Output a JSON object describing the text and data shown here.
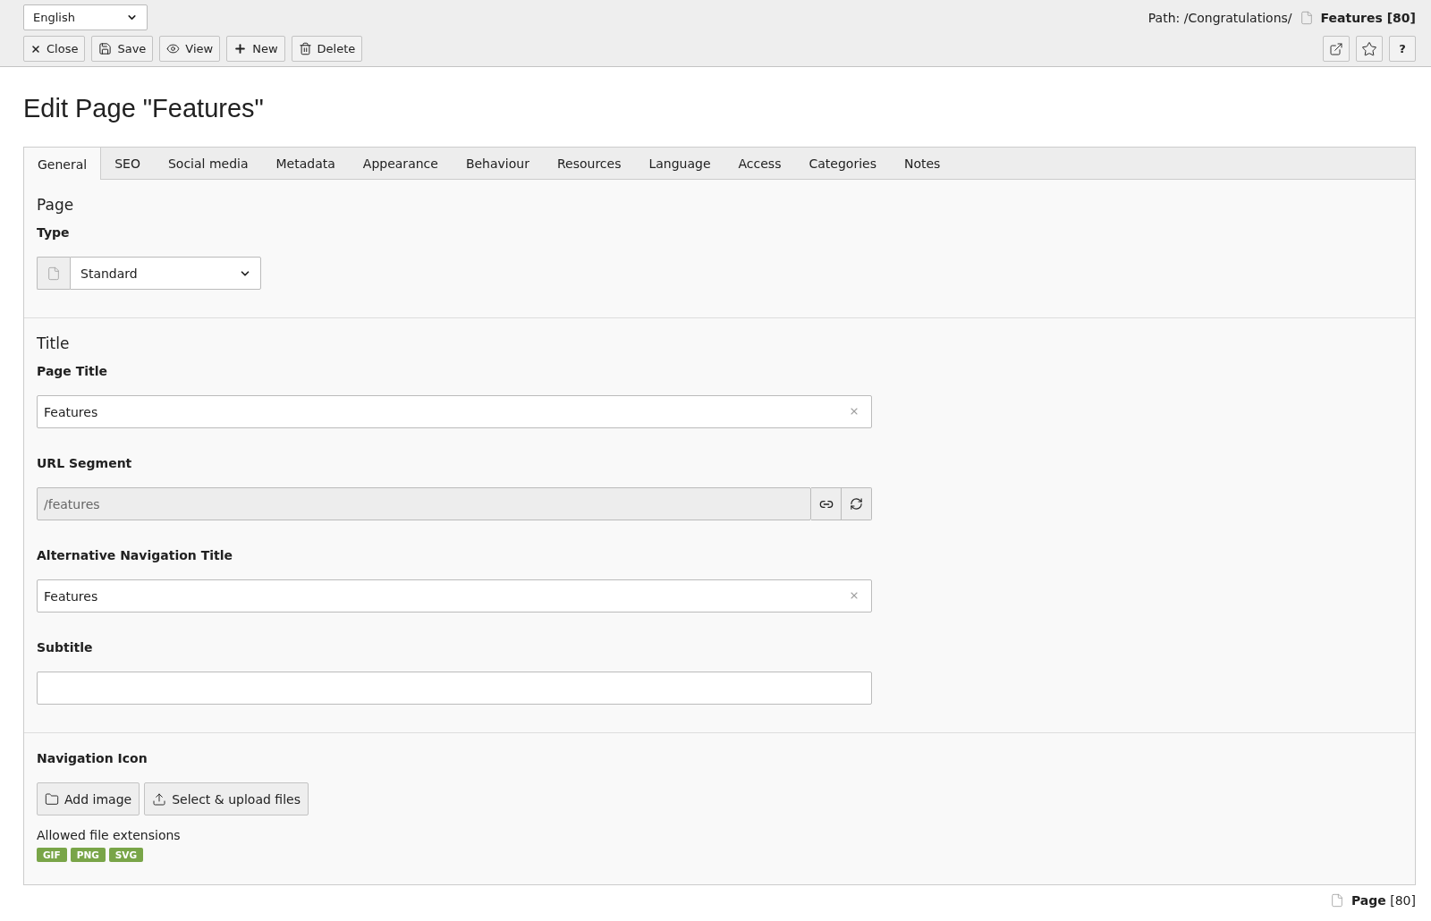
{
  "toolbar": {
    "language": {
      "value": "English"
    },
    "buttons": [
      {
        "kind": "close",
        "label": "Close"
      },
      {
        "kind": "save",
        "label": "Save"
      },
      {
        "kind": "view",
        "label": "View"
      },
      {
        "kind": "new",
        "label": "New"
      },
      {
        "kind": "delete",
        "label": "Delete"
      }
    ],
    "path": {
      "label": "Path: /Congratulations/",
      "current": "Features [80]"
    },
    "actions": [
      {
        "kind": "open-new-window"
      },
      {
        "kind": "bookmark"
      },
      {
        "kind": "help",
        "label": "?"
      }
    ]
  },
  "heading": "Edit Page \"Features\"",
  "tabs": [
    {
      "label": "General",
      "selected": true
    },
    {
      "label": "SEO",
      "selected": false
    },
    {
      "label": "Social media",
      "selected": false
    },
    {
      "label": "Metadata",
      "selected": false
    },
    {
      "label": "Appearance",
      "selected": false
    },
    {
      "label": "Behaviour",
      "selected": false
    },
    {
      "label": "Resources",
      "selected": false
    },
    {
      "label": "Language",
      "selected": false
    },
    {
      "label": "Access",
      "selected": false
    },
    {
      "label": "Categories",
      "selected": false
    },
    {
      "label": "Notes",
      "selected": false
    }
  ],
  "sections": [
    {
      "title": "Page",
      "fields": [
        {
          "kind": "select",
          "label": "Type",
          "value": "Standard"
        }
      ]
    },
    {
      "title": "Title",
      "fields": [
        {
          "kind": "text",
          "label": "Page Title",
          "value": "Features"
        },
        {
          "kind": "slug",
          "label": "URL Segment",
          "value": "/features"
        },
        {
          "kind": "text",
          "label": "Alternative Navigation Title",
          "value": "Features"
        },
        {
          "kind": "text",
          "label": "Subtitle"
        }
      ]
    },
    {
      "fields": [
        {
          "kind": "file",
          "label": "Navigation Icon",
          "buttons": [
            {
              "kind": "add-image",
              "label": "Add image"
            },
            {
              "kind": "upload",
              "label": "Select & upload files"
            }
          ],
          "note": "Allowed file extensions",
          "extensions": [
            "GIF",
            "PNG",
            "SVG"
          ]
        }
      ]
    }
  ],
  "footer": {
    "record": "**Page** [80]"
  }
}
